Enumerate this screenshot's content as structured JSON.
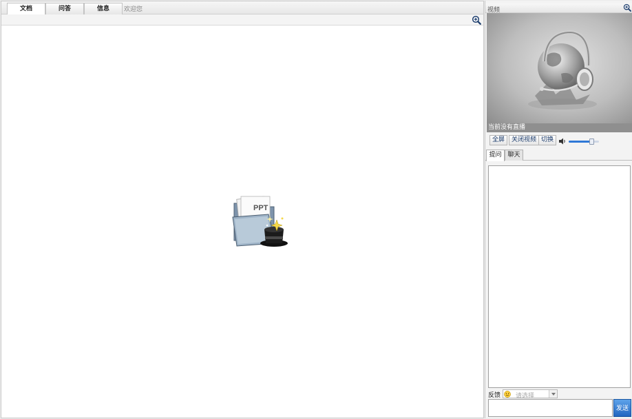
{
  "doc_panel": {
    "tabs": [
      {
        "label": "文档",
        "active": true
      },
      {
        "label": "问答",
        "active": false
      },
      {
        "label": "信息",
        "active": false
      }
    ],
    "welcome": "欢迎您",
    "placeholder_icon": "ppt-folder-magic-hat-icon",
    "placeholder_logo_text": "PPT"
  },
  "video_panel": {
    "title": "视频",
    "status": "当前没有直播",
    "buttons": {
      "fullscreen": "全屏",
      "close_video": "关闭视频",
      "switch": "切换"
    },
    "volume": 0.8
  },
  "qa_panel": {
    "tabs": [
      {
        "label": "提问",
        "active": true
      },
      {
        "label": "聊天",
        "active": false
      }
    ],
    "feedback_label": "反馈",
    "feedback_select": "请选择",
    "send_label": "发送"
  },
  "colors": {
    "accent": "#2f78d7",
    "send_button": "#2165c0",
    "status_bar": "#8f8f8f"
  }
}
